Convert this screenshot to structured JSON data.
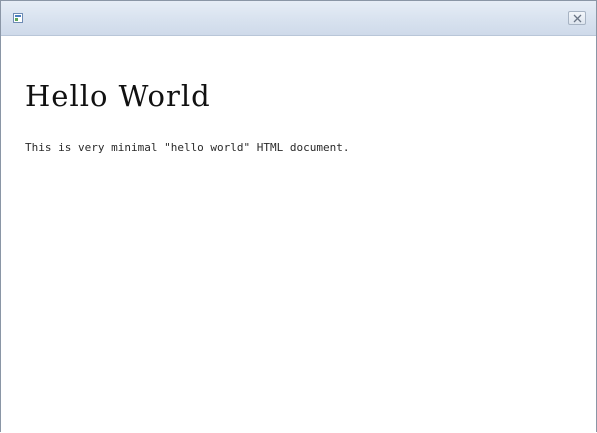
{
  "window": {
    "title": "",
    "icon": "app-icon",
    "close_icon": "close-icon"
  },
  "document": {
    "heading": "Hello World",
    "paragraph": "This is very minimal \"hello world\" HTML document."
  },
  "colors": {
    "titlebar": "#d8e2ef",
    "background": "#ffffff",
    "text": "#1e1e1e"
  }
}
